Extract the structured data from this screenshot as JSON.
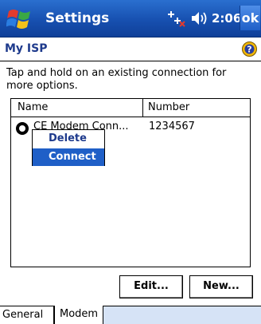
{
  "titlebar": {
    "title": "Settings",
    "time": "2:06",
    "ok_label": "ok"
  },
  "header": {
    "title": "My ISP"
  },
  "instructions": "Tap and hold on an existing connection for more options.",
  "list": {
    "columns": [
      "Name",
      "Number"
    ],
    "rows": [
      {
        "name": "CE Modem Conn...",
        "number": "1234567"
      }
    ]
  },
  "context_menu": {
    "items": [
      "Delete",
      "Connect"
    ],
    "selected": "Connect"
  },
  "buttons": {
    "edit": "Edit...",
    "new": "New..."
  },
  "tabs": [
    "General",
    "Modem"
  ],
  "colors": {
    "titlebar": "#1750b0",
    "accent": "#1f5fc7",
    "heading": "#1e3a8c"
  }
}
